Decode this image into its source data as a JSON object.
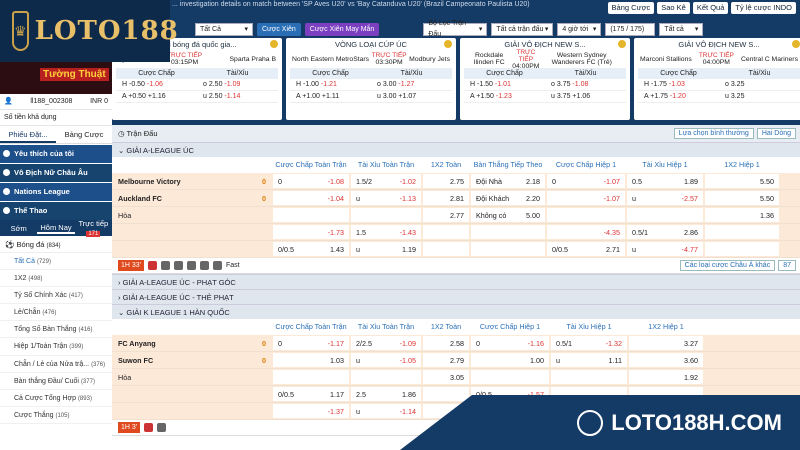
{
  "brand": {
    "logo_text": "LOTO188",
    "watermark": "LOTO188H.COM"
  },
  "ticker": "... investigation details on match between 'SP Aves U20' vs 'Bay Catanduva U20' (Brazil Campeonato Paulista U20)",
  "top_buttons": [
    "Bảng Cược",
    "Sao Kê",
    "Kết Quả",
    "Tỷ lệ cược INDO"
  ],
  "filters": {
    "all": "Tất Cả",
    "live_bets": "Cược Xiên",
    "lucky_bets": "Cược Xiên May Mắn",
    "league_filter": "Bộ Lọc Trận Đấu",
    "all_matches": "Tất cả trận đấu",
    "time": "4 giờ tới",
    "pages": "(175 / 175)",
    "all2": "Tất cả"
  },
  "cards": [
    {
      "title": "Giải bóng đá quốc gia...",
      "home": "Vyskov",
      "away": "Sparta Praha B",
      "status": "TRỰC TIẾP",
      "time": "03:15PM",
      "lines": [
        [
          "H",
          "-0.50",
          "-1.06",
          "o",
          "2.50",
          "-1.09"
        ],
        [
          "A",
          "+0.50",
          "+1.16",
          "u",
          "2.50",
          "-1.14"
        ]
      ]
    },
    {
      "title": "VÒNG LOẠI CÚP ÚC",
      "home": "North Eastern MetroStars",
      "away": "Modbury Jets",
      "status": "TRỰC TIẾP",
      "time": "03:30PM",
      "lines": [
        [
          "H",
          "-1.00",
          "-1.21",
          "o",
          "3.00",
          "-1.27"
        ],
        [
          "A",
          "+1.00",
          "+1.11",
          "u",
          "3.00",
          "+1.07"
        ]
      ]
    },
    {
      "title": "GIẢI VÔ ĐỊCH NEW S...",
      "home": "Rockdale Ilinden FC",
      "away": "Western Sydney Wanderers FC (Trẻ)",
      "status": "TRỰC TIẾP",
      "time": "04:00PM",
      "lines": [
        [
          "H",
          "-1.50",
          "-1.01",
          "o",
          "3.75",
          "-1.08"
        ],
        [
          "A",
          "+1.50",
          "-1.23",
          "u",
          "3.75",
          "+1.06"
        ]
      ]
    },
    {
      "title": "GIẢI VÔ ĐỊCH NEW S...",
      "home": "Marconi Stallions",
      "away": "Central C Mariners",
      "status": "TRỰC TIẾP",
      "time": "04:00PM",
      "lines": [
        [
          "H",
          "-1.75",
          "-1.03",
          "o",
          "3.25",
          ""
        ],
        [
          "A",
          "+1.75",
          "-1.20",
          "u",
          "3.25",
          ""
        ]
      ]
    }
  ],
  "card_sub": {
    "handicap": "Cược Chấp",
    "ou": "Tài/Xỉu"
  },
  "sidebar": {
    "banner": "Tường Thuật",
    "account": "ll188_002308",
    "inr": "INR 0",
    "balance": "Số tiền khả dụng",
    "tabs": [
      "Phiếu Đặt...",
      "Bảng Cược"
    ],
    "nav": [
      "Yêu thích của tôi",
      "Vô Địch Nữ Châu Âu",
      "Nations League",
      "Thể Thao"
    ],
    "subtabs": [
      "Sớm",
      "Hôm Nay",
      "Trực tiếp"
    ],
    "live_count": "171",
    "sport": "Bóng đá",
    "sport_count": "(834)",
    "items": [
      [
        "Tất Cả",
        "(729)"
      ],
      [
        "1X2",
        "(498)"
      ],
      [
        "Tỷ Số Chính Xác",
        "(417)"
      ],
      [
        "Lẻ/Chẵn",
        "(476)"
      ],
      [
        "Tổng Số Bàn Thắng",
        "(416)"
      ],
      [
        "Hiệp 1/Toàn Trận",
        "(399)"
      ],
      [
        "Chẵn / Lẻ của Nửa trậ...",
        "(376)"
      ],
      [
        "Bàn thắng Đầu/ Cuối",
        "(377)"
      ],
      [
        "Cả Cược Tổng Hợp",
        "(893)"
      ],
      [
        "Cược Thắng",
        "(105)"
      ]
    ]
  },
  "main": {
    "section": "Trận Đấu",
    "sort": "Lựa chọn bình thường",
    "view": "Hai Dòng",
    "headers": [
      "Cược Chấp Toàn Trận",
      "Tài Xỉu Toàn Trận",
      "1X2 Toàn Trận",
      "Bàn Thắng Tiếp Theo",
      "Cược Chấp Hiệp 1",
      "Tài Xỉu Hiệp 1",
      "1X2 Hiệp 1"
    ],
    "headers2": [
      "Cược Chấp Toàn Trận",
      "Tài Xỉu Toàn Trận",
      "1X2 Toàn Trận",
      "Cược Chấp Hiệp 1",
      "Tài Xỉu Hiệp 1",
      "1X2 Hiệp 1"
    ],
    "leagues": [
      "GIẢI A-LEAGUE ÚC",
      "GIẢI A-LEAGUE ÚC - PHẠT GÓC",
      "GIẢI A-LEAGUE ÚC - THẺ PHẠT",
      "GIẢI K LEAGUE 1 HÀN QUỐC"
    ],
    "match1": {
      "home": "Melbourne Victory",
      "away": "Auckland FC",
      "draw": "Hòa",
      "hs": "0",
      "as": "0",
      "live": "1H 33'",
      "fast": "Fast",
      "odds_filter": "Các loại cược Châu Á khác",
      "count": "87",
      "rows": [
        [
          "0",
          "-1.08",
          "1.5/2",
          "-1.02",
          "2.75",
          "Đội Nhà",
          "2.18",
          "0",
          "-1.07",
          "0.5",
          "1.89",
          "5.50"
        ],
        [
          "",
          "-1.04",
          "u",
          "-1.13",
          "2.81",
          "Đội Khách",
          "2.20",
          "",
          "-1.07",
          "u",
          "-2.57",
          "5.50"
        ],
        [
          "",
          "",
          "",
          "",
          "2.77",
          "Không có",
          "5.00",
          "",
          "",
          "",
          "",
          "1.36"
        ],
        [
          "",
          "-1.73",
          "1.5",
          "-1.43",
          "",
          "",
          "",
          "",
          "-4.35",
          "0.5/1",
          "2.86",
          ""
        ],
        [
          "0/0.5",
          "1.43",
          "u",
          "1.19",
          "",
          "",
          "",
          "0/0.5",
          "2.71",
          "u",
          "-4.77",
          ""
        ]
      ]
    },
    "match2": {
      "home": "FC Anyang",
      "away": "Suwon FC",
      "draw": "Hòa",
      "hs": "0",
      "as": "0",
      "live": "1H 3'",
      "rows": [
        [
          "0",
          "-1.17",
          "2/2.5",
          "-1.09",
          "2.58",
          "0",
          "-1.16",
          "0.5/1",
          "-1.32",
          "3.27"
        ],
        [
          "",
          "1.03",
          "u",
          "-1.05",
          "2.79",
          "",
          "1.00",
          "u",
          "1.11",
          "3.60"
        ],
        [
          "",
          "",
          "",
          "",
          "3.05",
          "",
          "",
          "",
          "",
          "1.92"
        ],
        [
          "0/0.5",
          "1.17",
          "2.5",
          "1.86",
          "",
          "0/0.5",
          "-1.57",
          "",
          "",
          ""
        ],
        [
          "",
          "-1.37",
          "u",
          "-1.14",
          "",
          "",
          "",
          "",
          "",
          ""
        ]
      ]
    }
  }
}
